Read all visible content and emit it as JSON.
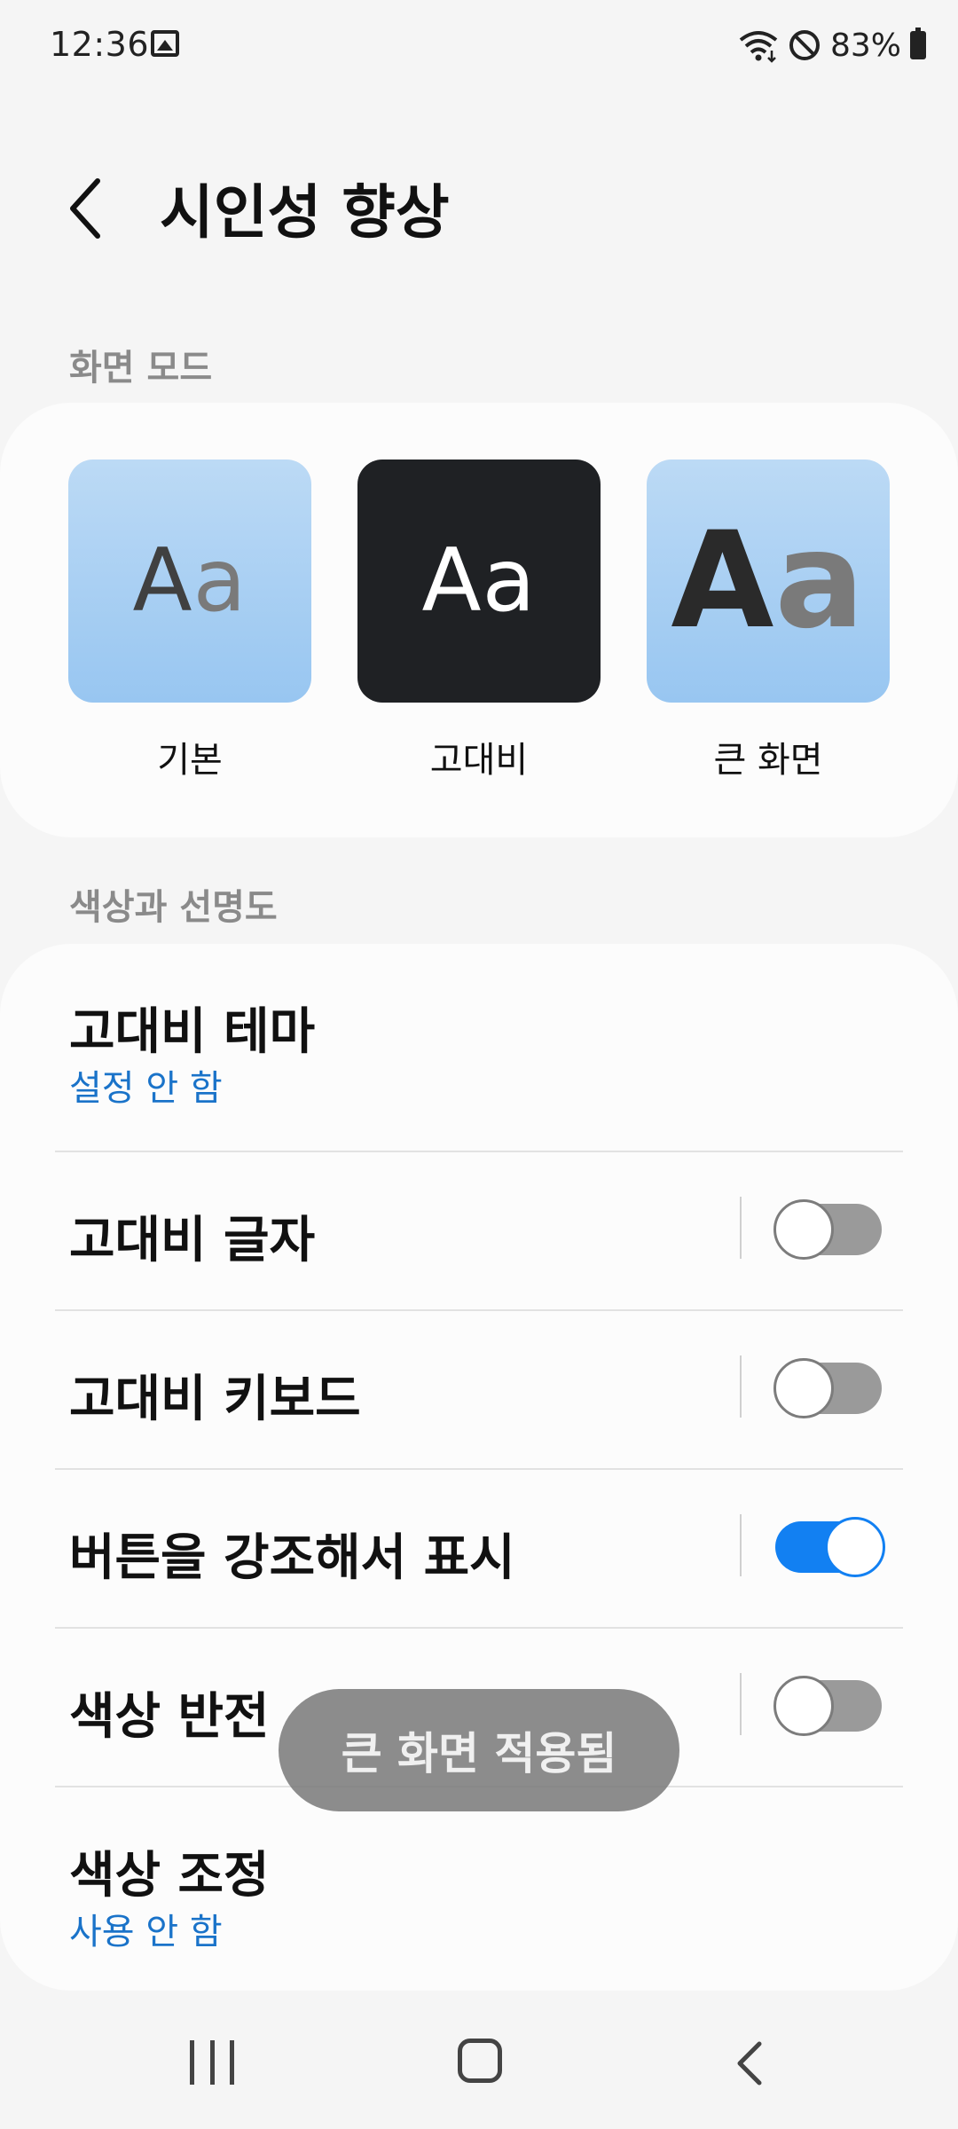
{
  "status_bar": {
    "time": "12:36",
    "battery": "83%",
    "icons": [
      "gallery-icon",
      "wifi-icon",
      "do-not-disturb-icon",
      "battery-icon"
    ]
  },
  "header": {
    "title": "시인성 향상",
    "back_icon": "chevron-left-icon"
  },
  "screen_mode": {
    "section_label": "화면 모드",
    "tiles": [
      {
        "label": "기본",
        "sample_a": "A",
        "sample_b": "a"
      },
      {
        "label": "고대비",
        "sample": "Aa"
      },
      {
        "label": "큰 화면",
        "sample_a": "A",
        "sample_b": "a"
      }
    ]
  },
  "color_clarity": {
    "section_label": "색상과 선명도",
    "items": [
      {
        "title": "고대비 테마",
        "subtitle": "설정 안 함"
      },
      {
        "title": "고대비 글자",
        "toggle": false
      },
      {
        "title": "고대비 키보드",
        "toggle": false
      },
      {
        "title": "버튼을 강조해서 표시",
        "toggle": true
      },
      {
        "title": "색상 반전",
        "toggle": false
      },
      {
        "title": "색상 조정",
        "subtitle": "사용 안 함"
      }
    ]
  },
  "toast": {
    "text": "큰 화면 적용됨"
  },
  "colors": {
    "accent": "#1280f2",
    "link_blue": "#1a73c9",
    "toggle_off": "#9a9a9a",
    "dark_tile": "#1f2124",
    "light_tile": "#a8cff3"
  },
  "nav_bar": {
    "icons": [
      "recents-icon",
      "home-icon",
      "back-icon"
    ]
  }
}
